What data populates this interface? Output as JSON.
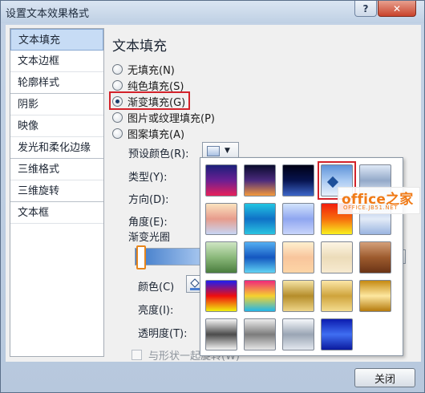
{
  "window": {
    "title": "设置文本效果格式",
    "help_label": "?",
    "close_label": "✕"
  },
  "nav": {
    "items": [
      {
        "label": "文本填充"
      },
      {
        "label": "文本边框"
      },
      {
        "label": "轮廓样式"
      },
      {
        "label": "阴影"
      },
      {
        "label": "映像"
      },
      {
        "label": "发光和柔化边缘"
      },
      {
        "label": "三维格式"
      },
      {
        "label": "三维旋转"
      },
      {
        "label": "文本框"
      }
    ],
    "selected_index": 0
  },
  "pane": {
    "title": "文本填充",
    "fill_options": [
      {
        "label": "无填充(N)",
        "checked": false
      },
      {
        "label": "纯色填充(S)",
        "checked": false
      },
      {
        "label": "渐变填充(G)",
        "checked": true
      },
      {
        "label": "图片或纹理填充(P)",
        "checked": false
      },
      {
        "label": "图案填充(A)",
        "checked": false
      }
    ],
    "preset_label": "预设颜色(R):",
    "type_label": "类型(Y):",
    "direction_label": "方向(D):",
    "angle_label": "角度(E):",
    "gradient_stops_label": "渐变光圈",
    "color_label": "颜色(C)",
    "brightness_label": "亮度(I):",
    "transparency_label": "透明度(T):",
    "rotate_with_shape_label": "与形状一起旋转(W)"
  },
  "footer": {
    "close_button": "关闭"
  },
  "gallery": {
    "selected_index": 3,
    "swatches": [
      {
        "name": "early-sunset",
        "colors": [
          "#1b1f7a",
          "#6b1f92",
          "#e8205a"
        ]
      },
      {
        "name": "late-sunset",
        "colors": [
          "#0a0b2e",
          "#4b2a7d",
          "#f49a3c"
        ]
      },
      {
        "name": "nightfall",
        "colors": [
          "#000015",
          "#07134f",
          "#3d66c9"
        ]
      },
      {
        "name": "daybreak",
        "colors": [
          "#5f94d9",
          "#a8c9f2",
          "#e8f1fc"
        ]
      },
      {
        "name": "horizon",
        "colors": [
          "#dfe9f7",
          "#93a9c9",
          "#e6eef8"
        ]
      },
      {
        "name": "desert",
        "colors": [
          "#fbe3bf",
          "#e79c8c",
          "#c8d6f4"
        ]
      },
      {
        "name": "ocean",
        "colors": [
          "#23c5e2",
          "#0f71c7",
          "#2ac4e1"
        ]
      },
      {
        "name": "calm-water",
        "colors": [
          "#d2e3fc",
          "#8fa6f0",
          "#c9d5fb"
        ]
      },
      {
        "name": "fire",
        "colors": [
          "#f21d0d",
          "#f76d0d",
          "#f9f01f"
        ]
      },
      {
        "name": "fog",
        "colors": [
          "#a6bfe6",
          "#e3ebf7",
          "#9ab4e0"
        ]
      },
      {
        "name": "moss",
        "colors": [
          "#cfe6c3",
          "#8ab87a",
          "#4a7d3e"
        ]
      },
      {
        "name": "peacock",
        "colors": [
          "#53aff2",
          "#1457c0",
          "#60d3f4"
        ]
      },
      {
        "name": "wheat",
        "colors": [
          "#fff0cf",
          "#f8c59c",
          "#fdd5a6"
        ]
      },
      {
        "name": "parchment",
        "colors": [
          "#fdf5e4",
          "#ecdcb9",
          "#f7ead0"
        ]
      },
      {
        "name": "mahogany",
        "colors": [
          "#d4a07a",
          "#9d5b2e",
          "#6b3416"
        ]
      },
      {
        "name": "rainbow",
        "colors": [
          "#1e1ef0",
          "#f00e0e",
          "#f0f00e"
        ]
      },
      {
        "name": "rainbow-ii",
        "colors": [
          "#f0287a",
          "#f5d22e",
          "#21b6ea"
        ]
      },
      {
        "name": "gold",
        "colors": [
          "#f5e4a5",
          "#b58d2a",
          "#efd588"
        ]
      },
      {
        "name": "gold-ii",
        "colors": [
          "#fbe6a7",
          "#cfa43c",
          "#f4dd8f"
        ]
      },
      {
        "name": "brass",
        "colors": [
          "#c68a12",
          "#fde7a0",
          "#b57a0c"
        ]
      },
      {
        "name": "chrome",
        "colors": [
          "#f6f6f6",
          "#4c4c4c",
          "#f3f3f3"
        ]
      },
      {
        "name": "chrome-ii",
        "colors": [
          "#ededed",
          "#7c7c7c",
          "#e6e6e6"
        ]
      },
      {
        "name": "silver",
        "colors": [
          "#f6f8fb",
          "#9aa5b4",
          "#e3e8ef"
        ]
      },
      {
        "name": "sapphire",
        "colors": [
          "#0c1cb0",
          "#3f6ef2",
          "#0b1a9e"
        ]
      }
    ]
  },
  "watermark": {
    "brand_main": "office之家",
    "brand_sub": "OFFICE.JB51.NET",
    "accent": "#f07a16"
  },
  "colors": {
    "highlight_red": "#d3222a",
    "selected_nav_bg": "#c7dcf5"
  }
}
